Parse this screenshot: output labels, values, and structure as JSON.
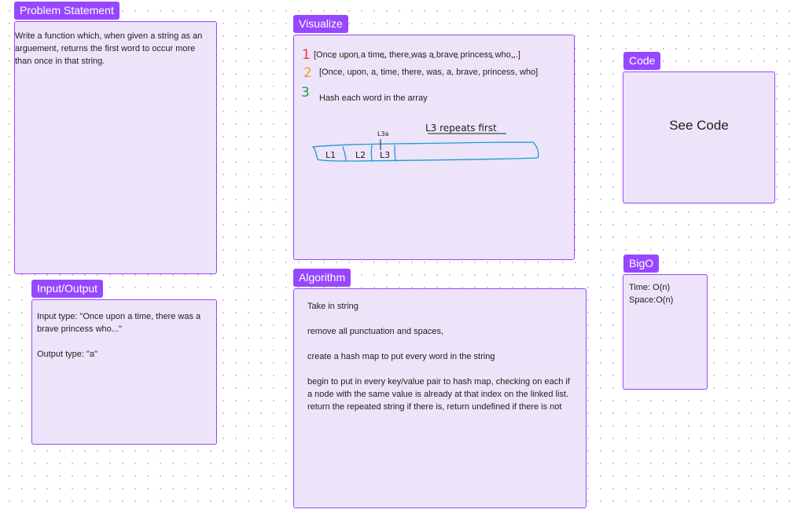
{
  "problem": {
    "title": "Problem Statement",
    "text": "Write a function which, when given a string as an arguement, returns the first word to occur more than once in that string."
  },
  "io": {
    "title": "Input/Output",
    "input": "Input type: \"Once upon a time, there was a brave princess who...\"",
    "output": "Output type: \"a\""
  },
  "visualize": {
    "title": "Visualize",
    "steps": [
      {
        "num": "1",
        "text": "[Once upon a time, there was a brave princess who...]",
        "color": "#e8412c"
      },
      {
        "num": "2",
        "text": "[Once, upon, a, time, there, was, a, brave, princess, who]",
        "color": "#f09a2a"
      },
      {
        "num": "3",
        "text": "Hash each word in the array",
        "color": "#1b9e4b"
      }
    ],
    "sketch": {
      "note": "L3 repeats first",
      "small": "L3a",
      "cells": [
        "L1",
        "L2",
        "L3"
      ]
    }
  },
  "algorithm": {
    "title": "Algorithm",
    "lines": [
      "Take in string",
      "remove all punctuation and spaces,",
      "create a hash map to put every word in the string",
      "begin to put in every key/value pair to hash map, checking on each if a node with the same value is already at that index on the linked list. return the repeated string if there is, return undefined if there is not"
    ]
  },
  "code": {
    "title": "Code",
    "text": "See Code"
  },
  "bigo": {
    "title": "BigO",
    "time": "Time: O(n)",
    "space": "Space:O(n)"
  },
  "colors": {
    "accent": "#9747ff",
    "card_fill": "#ede4f9",
    "sketch_blue": "#1e9ad6"
  }
}
